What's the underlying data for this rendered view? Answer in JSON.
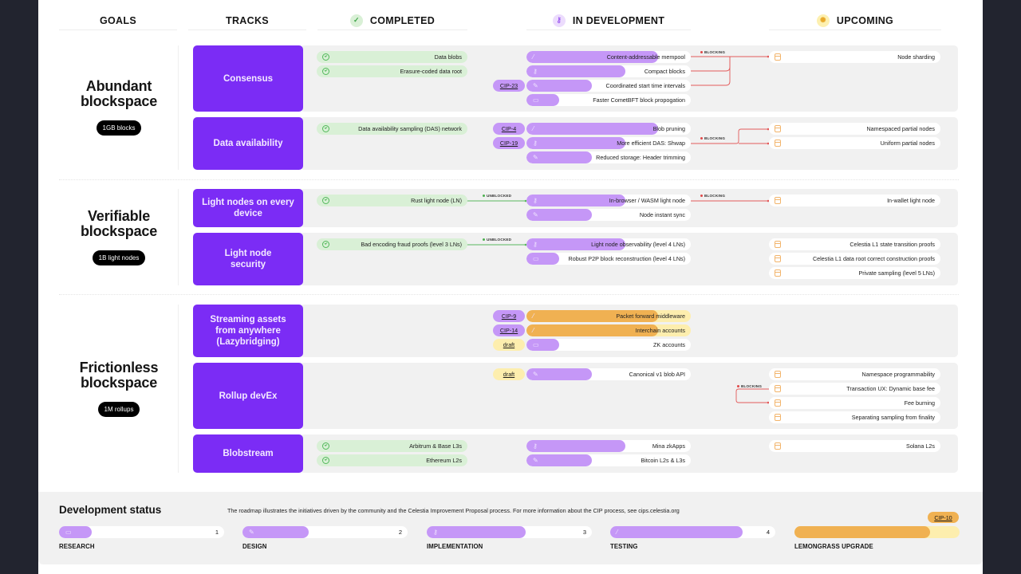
{
  "headers": {
    "goals": "GOALS",
    "tracks": "TRACKS",
    "completed": "COMPLETED",
    "in_development": "IN DEVELOPMENT",
    "upcoming": "UPCOMING"
  },
  "icons": {
    "completed": "check-circle-icon",
    "in_development": "key-icon",
    "upcoming": "sun-icon",
    "research": "book-icon",
    "design": "pen-icon",
    "implementation": "key-icon",
    "testing": "wand-icon",
    "upcoming_item": "calendar-icon"
  },
  "colors": {
    "track": "#7b2cf5",
    "stage_fill": "#c597f7",
    "completed": "#d9f0d6",
    "lemongrass": "#f0b152",
    "lemongrass_track": "#fdeeae",
    "blocking": "#e04848",
    "unblocked": "#4caf50",
    "panel": "#f1f1f1"
  },
  "goals": [
    {
      "title": "Abundant blockspace",
      "badge": "1GB blocks"
    },
    {
      "title": "Verifiable blockspace",
      "badge": "1B light nodes"
    },
    {
      "title": "Frictionless blockspace",
      "badge": "1M rollups"
    }
  ],
  "tracks": [
    {
      "name": "Consensus",
      "completed": [
        "Data blobs",
        "Erasure-coded data root"
      ],
      "in_development": [
        {
          "label": "Content-addressable mempool",
          "stage": "testing",
          "progress": 0.8,
          "cip": ""
        },
        {
          "label": "Compact blocks",
          "stage": "implementation",
          "progress": 0.6,
          "cip": ""
        },
        {
          "label": "Coordinated start time intervals",
          "stage": "design",
          "progress": 0.4,
          "cip": "CIP-23"
        },
        {
          "label": "Faster CometBFT block propogation",
          "stage": "research",
          "progress": 0.2,
          "cip": ""
        }
      ],
      "upcoming": [
        "Node sharding"
      ],
      "flags": [
        "BLOCKING"
      ]
    },
    {
      "name": "Data availability",
      "completed": [
        "Data availability sampling (DAS) network"
      ],
      "in_development": [
        {
          "label": "Blob pruning",
          "stage": "testing",
          "progress": 0.8,
          "cip": "CIP-4"
        },
        {
          "label": "More efficient DAS: Shwap",
          "stage": "implementation",
          "progress": 0.6,
          "cip": "CIP-19"
        },
        {
          "label": "Reduced storage: Header trimming",
          "stage": "design",
          "progress": 0.4,
          "cip": ""
        }
      ],
      "upcoming": [
        "Namespaced partial nodes",
        "Uniform partial nodes"
      ],
      "flags": [
        "BLOCKING"
      ]
    },
    {
      "name": "Light nodes on every device",
      "completed": [
        "Rust light node (LN)"
      ],
      "in_development": [
        {
          "label": "In-browser / WASM light node",
          "stage": "implementation",
          "progress": 0.6,
          "cip": ""
        },
        {
          "label": "Node instant sync",
          "stage": "design",
          "progress": 0.4,
          "cip": ""
        }
      ],
      "upcoming": [
        "In-wallet light node"
      ],
      "flags": [
        "UNBLOCKED",
        "BLOCKING"
      ]
    },
    {
      "name": "Light node security",
      "completed": [
        "Bad encoding fraud proofs (level 3 LNs)"
      ],
      "in_development": [
        {
          "label": "Light node observability (level 4 LNs)",
          "stage": "implementation",
          "progress": 0.6,
          "cip": ""
        },
        {
          "label": "Robust P2P block reconstruction (level 4 LNs)",
          "stage": "research",
          "progress": 0.2,
          "cip": ""
        }
      ],
      "upcoming": [
        "Celestia L1 state transition proofs",
        "Celestia L1 data root correct construction proofs",
        "Private sampling (level 5 LNs)"
      ],
      "flags": [
        "UNBLOCKED"
      ]
    },
    {
      "name": "Streaming assets from anywhere (Lazybridging)",
      "completed": [],
      "in_development": [
        {
          "label": "Packet forward middleware",
          "stage": "lemongrass",
          "progress": 0.8,
          "cip": "CIP-9"
        },
        {
          "label": "Interchain accounts",
          "stage": "lemongrass",
          "progress": 0.8,
          "cip": "CIP-14"
        },
        {
          "label": "ZK accounts",
          "stage": "research",
          "progress": 0.2,
          "cip": "draft"
        }
      ],
      "upcoming": [],
      "flags": []
    },
    {
      "name": "Rollup devEx",
      "completed": [],
      "in_development": [
        {
          "label": "Canonical v1 blob API",
          "stage": "design",
          "progress": 0.4,
          "cip": "draft"
        }
      ],
      "upcoming": [
        "Namespace programmability",
        "Transaction UX: Dynamic base fee",
        "Fee burning",
        "Separating sampling from finality"
      ],
      "flags": [
        "BLOCKING"
      ]
    },
    {
      "name": "Blobstream",
      "completed": [
        "Arbitrum & Base L3s",
        "Ethereum L2s"
      ],
      "in_development": [
        {
          "label": "Mina zkApps",
          "stage": "implementation",
          "progress": 0.6,
          "cip": ""
        },
        {
          "label": "Bitcoin L2s & L3s",
          "stage": "design",
          "progress": 0.4,
          "cip": ""
        }
      ],
      "upcoming": [
        "Solana L2s"
      ],
      "flags": []
    }
  ],
  "footer": {
    "title": "Development status",
    "description": "The roadmap illustrates the initiatives driven by the community and the Celestia Improvement Proposal process. For more information about the CIP process, see cips.celestia.org",
    "stages": [
      {
        "label": "RESEARCH",
        "number": "1",
        "progress": 0.2
      },
      {
        "label": "DESIGN",
        "number": "2",
        "progress": 0.4
      },
      {
        "label": "IMPLEMENTATION",
        "number": "3",
        "progress": 0.6
      },
      {
        "label": "TESTING",
        "number": "4",
        "progress": 0.8
      },
      {
        "label": "LEMONGRASS UPGRADE",
        "number": "",
        "progress": 0.82,
        "cip": "CIP-10"
      }
    ]
  }
}
